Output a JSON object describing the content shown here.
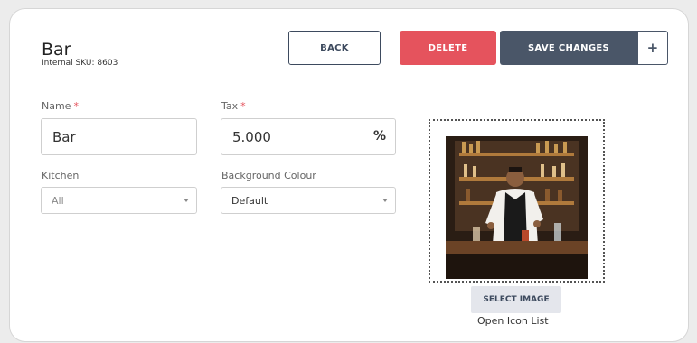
{
  "header": {
    "title": "Bar",
    "subtitle": "Internal SKU: 8603"
  },
  "toolbar": {
    "back_label": "BACK",
    "delete_label": "DELETE",
    "save_label": "SAVE CHANGES",
    "plus_label": "+"
  },
  "form": {
    "name_label": "Name",
    "name_value": "Bar",
    "tax_label": "Tax",
    "tax_value": "5.000",
    "tax_unit": "%",
    "required_mark": "*",
    "kitchen_label": "Kitchen",
    "kitchen_value": "All",
    "bg_label": "Background Colour",
    "bg_value": "Default"
  },
  "image": {
    "select_label": "SELECT IMAGE",
    "icon_list_label": "Open Icon List"
  },
  "colors": {
    "delete": "#e5535d",
    "save": "#4a5668",
    "accent_dark": "#3d4a5e"
  }
}
